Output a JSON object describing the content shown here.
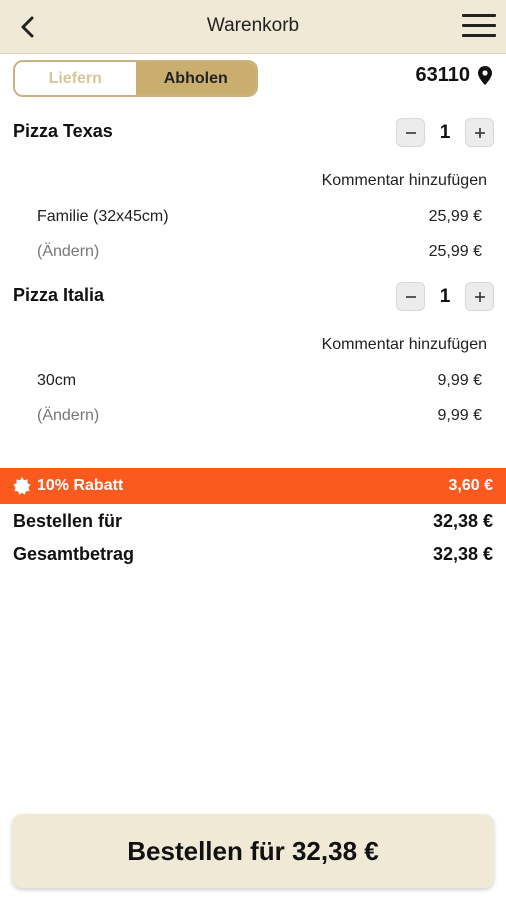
{
  "header": {
    "title": "Warenkorb",
    "back_icon": "chevron-left-icon",
    "menu_icon": "hamburger-menu-icon"
  },
  "mode_toggle": {
    "options": [
      "Liefern",
      "Abholen"
    ],
    "selected": "Abholen"
  },
  "location": {
    "postal_code": "63110",
    "icon": "map-pin-icon"
  },
  "cart": {
    "items": [
      {
        "name": "Pizza Texas",
        "quantity": "1",
        "comment_link": "Kommentar hinzufügen",
        "option_label": "Familie (32x45cm)",
        "option_price": "25,99 €",
        "change_label": "(Ändern)",
        "line_total": "25,99 €"
      },
      {
        "name": "Pizza Italia",
        "quantity": "1",
        "comment_link": "Kommentar hinzufügen",
        "option_label": "30cm",
        "option_price": "9,99 €",
        "change_label": "(Ändern)",
        "line_total": "9,99 €"
      }
    ]
  },
  "discount": {
    "label": "10% Rabatt",
    "value": "3,60 €",
    "color": "#fb5a1f",
    "icon": "badge-icon"
  },
  "summary": {
    "order_for_label": "Bestellen für",
    "order_for_value": "32,38 €",
    "total_label": "Gesamtbetrag",
    "total_value": "32,38 €"
  },
  "order_button": {
    "label": "Bestellen für 32,38 €"
  },
  "colors": {
    "header_bg": "#f0e9d6",
    "accent_gold": "#c9ae70"
  }
}
